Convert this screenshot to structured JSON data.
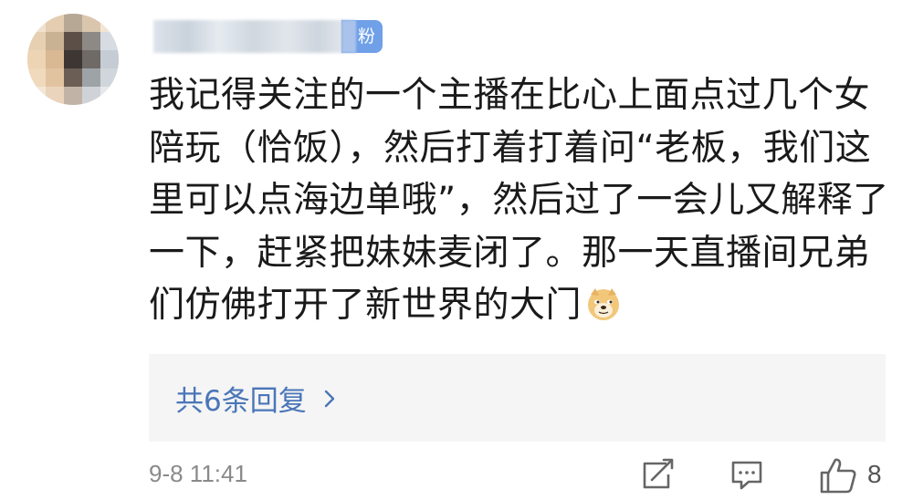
{
  "user": {
    "badge": "粉"
  },
  "comment": {
    "lines": [
      "我记得关注的一个主播在比心上面点过几个女",
      "陪玩（恰饭），然后打着打着问“老板，我们这",
      "里可以点海边单哦”，然后过了一会儿又解释了",
      "一下，赶紧把妹妹麦闭了。那一天直播间兄弟",
      "们仿佛打开了新世界的大门"
    ],
    "emoji": "doge-icon"
  },
  "replies": {
    "label": "共6条回复"
  },
  "meta": {
    "time": "9-8 11:41",
    "likes": "8"
  },
  "colors": {
    "link": "#4a76b8",
    "badge": "#6fa0e8",
    "reply_bg": "#f5f5f5",
    "text": "#1a1a1a",
    "muted": "#8a8a8a"
  }
}
